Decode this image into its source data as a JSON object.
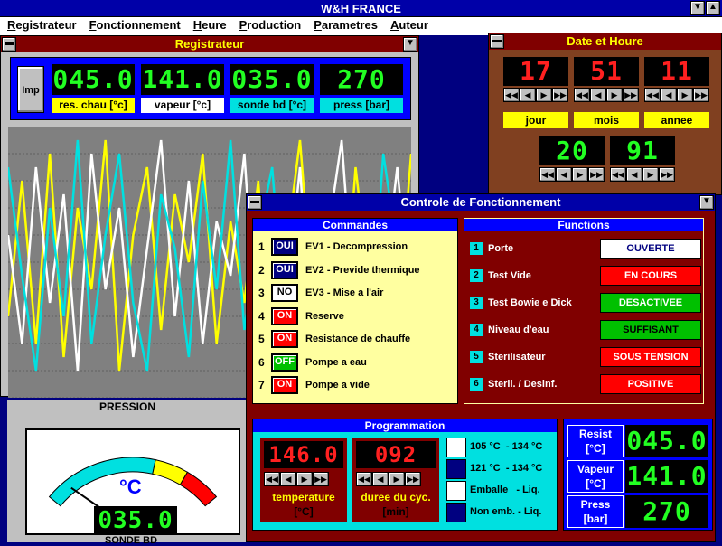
{
  "app": {
    "title": "W&H FRANCE"
  },
  "menu": [
    "Registrateur",
    "Fonctionnement",
    "Heure",
    "Production",
    "Parametres",
    "Auteur"
  ],
  "registrateur": {
    "title": "Registrateur",
    "imp_label": "Imp",
    "readouts": [
      {
        "value": "045.0",
        "label": "res. chau [°c]",
        "color": "#ffff00"
      },
      {
        "value": "141.0",
        "label": "vapeur [°c]",
        "color": "#ffffff"
      },
      {
        "value": "035.0",
        "label": "sonde bd [°c]",
        "color": "#00e0e0"
      },
      {
        "value": "270",
        "label": "press [bar]",
        "color": "#00e0e0"
      }
    ]
  },
  "pression": {
    "title": "PRESSION",
    "unit": "°C",
    "value": "035.0",
    "footer": "SONDE BD",
    "needle_fraction": 0.12
  },
  "date": {
    "title": "Date et Houre",
    "fields": [
      {
        "value": "17",
        "label": "jour"
      },
      {
        "value": "51",
        "label": "mois"
      },
      {
        "value": "11",
        "label": "annee"
      }
    ],
    "fields2": [
      {
        "value": "20"
      },
      {
        "value": "91"
      }
    ]
  },
  "controle": {
    "title": "Controle de Fonctionnement",
    "commandes_title": "Commandes",
    "commandes": [
      {
        "num": "1",
        "state": "OUI",
        "label": "EV1 - Decompression",
        "bg": "#000080",
        "fg": "#ffffff"
      },
      {
        "num": "2",
        "state": "OUI",
        "label": "EV2 - Previde thermique",
        "bg": "#000080",
        "fg": "#ffffff"
      },
      {
        "num": "3",
        "state": "NO",
        "label": "EV3 - Mise a l'air",
        "bg": "#ffffff",
        "fg": "#000000"
      },
      {
        "num": "4",
        "state": "ON",
        "label": "Reserve",
        "bg": "#ff0000",
        "fg": "#ffffff"
      },
      {
        "num": "5",
        "state": "ON",
        "label": "Resistance de chauffe",
        "bg": "#ff0000",
        "fg": "#ffffff"
      },
      {
        "num": "6",
        "state": "OFF",
        "label": "Pompe a eau",
        "bg": "#00c000",
        "fg": "#ffffff"
      },
      {
        "num": "7",
        "state": "ON",
        "label": "Pompe a vide",
        "bg": "#ff0000",
        "fg": "#ffffff"
      }
    ],
    "functions_title": "Functions",
    "functions": [
      {
        "num": "1",
        "label": "Porte",
        "status": "OUVERTE",
        "bg": "#ffffff",
        "fg": "#000080"
      },
      {
        "num": "2",
        "label": "Test Vide",
        "status": "EN COURS",
        "bg": "#ff0000",
        "fg": "#ffffff"
      },
      {
        "num": "3",
        "label": "Test Bowie e Dick",
        "status": "DESACTIVEE",
        "bg": "#00c000",
        "fg": "#ffffff"
      },
      {
        "num": "4",
        "label": "Niveau d'eau",
        "status": "SUFFISANT",
        "bg": "#00c000",
        "fg": "#000000"
      },
      {
        "num": "5",
        "label": "Sterilisateur",
        "status": "SOUS TENSION",
        "bg": "#ff0000",
        "fg": "#ffffff"
      },
      {
        "num": "6",
        "label": "Steril. / Desinf.",
        "status": "POSITIVE",
        "bg": "#ff0000",
        "fg": "#ffffff"
      }
    ],
    "programmation_title": "Programmation",
    "temperature": {
      "value": "146.0",
      "label1": "temperature",
      "label2": "[°C]"
    },
    "duree": {
      "value": "092",
      "label1": "duree du cyc.",
      "label2": "[min]"
    },
    "options": [
      {
        "label": "105 °C  - 134 °C",
        "selected": false
      },
      {
        "label": "121 °C  - 134 °C",
        "selected": true
      },
      {
        "label": "Emballe   - Liq.",
        "selected": false
      },
      {
        "label": "Non emb. - Liq.",
        "selected": true
      }
    ],
    "side": [
      {
        "label1": "Resist",
        "label2": "[°C]",
        "value": "045.0"
      },
      {
        "label1": "Vapeur",
        "label2": "[°C]",
        "value": "141.0"
      },
      {
        "label1": "Press",
        "label2": "[bar]",
        "value": "270"
      }
    ]
  },
  "colors": {
    "desktop": "#000080",
    "titlebar": "#800000",
    "panel_blue": "#0000ff",
    "cyan": "#00e0e0",
    "cream": "#ffffa0"
  },
  "chart_data": {
    "type": "line",
    "series": [
      {
        "color": "#ffff00",
        "values": [
          30,
          80,
          20,
          90,
          15,
          70,
          40,
          95,
          10,
          60,
          85,
          25,
          75,
          50,
          90,
          20,
          65,
          35,
          80,
          10,
          55,
          95,
          30,
          70,
          15,
          85,
          40,
          60,
          25,
          90
        ]
      },
      {
        "color": "#ffffff",
        "values": [
          60,
          20,
          85,
          35,
          75,
          10,
          90,
          40,
          70,
          15,
          55,
          95,
          30,
          80,
          20,
          65,
          45,
          90,
          15,
          75,
          35,
          85,
          10,
          60,
          95,
          25,
          70,
          40,
          85,
          30
        ]
      },
      {
        "color": "#00e0e0",
        "values": [
          85,
          45,
          10,
          70,
          30,
          95,
          20,
          60,
          90,
          35,
          10,
          75,
          55,
          15,
          80,
          40,
          95,
          25,
          60,
          85,
          20,
          45,
          75,
          10,
          50,
          70,
          20,
          90,
          55,
          15
        ]
      }
    ],
    "ylim": [
      0,
      100
    ],
    "grid": true
  }
}
